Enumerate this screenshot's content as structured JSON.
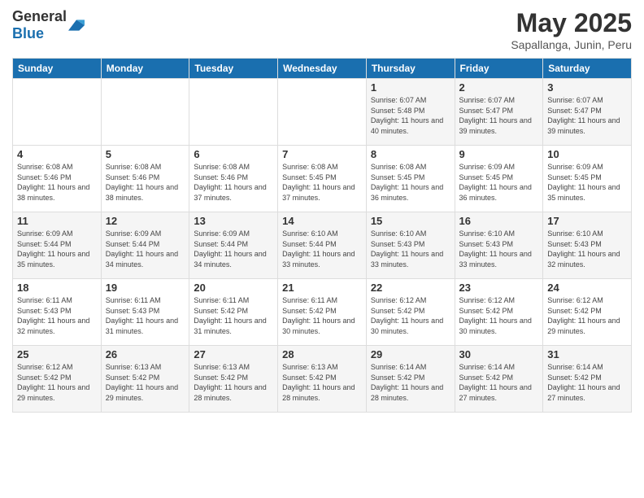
{
  "logo": {
    "general": "General",
    "blue": "Blue"
  },
  "title": "May 2025",
  "subtitle": "Sapallanga, Junin, Peru",
  "headers": [
    "Sunday",
    "Monday",
    "Tuesday",
    "Wednesday",
    "Thursday",
    "Friday",
    "Saturday"
  ],
  "weeks": [
    [
      {
        "day": "",
        "sunrise": "",
        "sunset": "",
        "daylight": ""
      },
      {
        "day": "",
        "sunrise": "",
        "sunset": "",
        "daylight": ""
      },
      {
        "day": "",
        "sunrise": "",
        "sunset": "",
        "daylight": ""
      },
      {
        "day": "",
        "sunrise": "",
        "sunset": "",
        "daylight": ""
      },
      {
        "day": "1",
        "sunrise": "Sunrise: 6:07 AM",
        "sunset": "Sunset: 5:48 PM",
        "daylight": "Daylight: 11 hours and 40 minutes."
      },
      {
        "day": "2",
        "sunrise": "Sunrise: 6:07 AM",
        "sunset": "Sunset: 5:47 PM",
        "daylight": "Daylight: 11 hours and 39 minutes."
      },
      {
        "day": "3",
        "sunrise": "Sunrise: 6:07 AM",
        "sunset": "Sunset: 5:47 PM",
        "daylight": "Daylight: 11 hours and 39 minutes."
      }
    ],
    [
      {
        "day": "4",
        "sunrise": "Sunrise: 6:08 AM",
        "sunset": "Sunset: 5:46 PM",
        "daylight": "Daylight: 11 hours and 38 minutes."
      },
      {
        "day": "5",
        "sunrise": "Sunrise: 6:08 AM",
        "sunset": "Sunset: 5:46 PM",
        "daylight": "Daylight: 11 hours and 38 minutes."
      },
      {
        "day": "6",
        "sunrise": "Sunrise: 6:08 AM",
        "sunset": "Sunset: 5:46 PM",
        "daylight": "Daylight: 11 hours and 37 minutes."
      },
      {
        "day": "7",
        "sunrise": "Sunrise: 6:08 AM",
        "sunset": "Sunset: 5:45 PM",
        "daylight": "Daylight: 11 hours and 37 minutes."
      },
      {
        "day": "8",
        "sunrise": "Sunrise: 6:08 AM",
        "sunset": "Sunset: 5:45 PM",
        "daylight": "Daylight: 11 hours and 36 minutes."
      },
      {
        "day": "9",
        "sunrise": "Sunrise: 6:09 AM",
        "sunset": "Sunset: 5:45 PM",
        "daylight": "Daylight: 11 hours and 36 minutes."
      },
      {
        "day": "10",
        "sunrise": "Sunrise: 6:09 AM",
        "sunset": "Sunset: 5:45 PM",
        "daylight": "Daylight: 11 hours and 35 minutes."
      }
    ],
    [
      {
        "day": "11",
        "sunrise": "Sunrise: 6:09 AM",
        "sunset": "Sunset: 5:44 PM",
        "daylight": "Daylight: 11 hours and 35 minutes."
      },
      {
        "day": "12",
        "sunrise": "Sunrise: 6:09 AM",
        "sunset": "Sunset: 5:44 PM",
        "daylight": "Daylight: 11 hours and 34 minutes."
      },
      {
        "day": "13",
        "sunrise": "Sunrise: 6:09 AM",
        "sunset": "Sunset: 5:44 PM",
        "daylight": "Daylight: 11 hours and 34 minutes."
      },
      {
        "day": "14",
        "sunrise": "Sunrise: 6:10 AM",
        "sunset": "Sunset: 5:44 PM",
        "daylight": "Daylight: 11 hours and 33 minutes."
      },
      {
        "day": "15",
        "sunrise": "Sunrise: 6:10 AM",
        "sunset": "Sunset: 5:43 PM",
        "daylight": "Daylight: 11 hours and 33 minutes."
      },
      {
        "day": "16",
        "sunrise": "Sunrise: 6:10 AM",
        "sunset": "Sunset: 5:43 PM",
        "daylight": "Daylight: 11 hours and 33 minutes."
      },
      {
        "day": "17",
        "sunrise": "Sunrise: 6:10 AM",
        "sunset": "Sunset: 5:43 PM",
        "daylight": "Daylight: 11 hours and 32 minutes."
      }
    ],
    [
      {
        "day": "18",
        "sunrise": "Sunrise: 6:11 AM",
        "sunset": "Sunset: 5:43 PM",
        "daylight": "Daylight: 11 hours and 32 minutes."
      },
      {
        "day": "19",
        "sunrise": "Sunrise: 6:11 AM",
        "sunset": "Sunset: 5:43 PM",
        "daylight": "Daylight: 11 hours and 31 minutes."
      },
      {
        "day": "20",
        "sunrise": "Sunrise: 6:11 AM",
        "sunset": "Sunset: 5:42 PM",
        "daylight": "Daylight: 11 hours and 31 minutes."
      },
      {
        "day": "21",
        "sunrise": "Sunrise: 6:11 AM",
        "sunset": "Sunset: 5:42 PM",
        "daylight": "Daylight: 11 hours and 30 minutes."
      },
      {
        "day": "22",
        "sunrise": "Sunrise: 6:12 AM",
        "sunset": "Sunset: 5:42 PM",
        "daylight": "Daylight: 11 hours and 30 minutes."
      },
      {
        "day": "23",
        "sunrise": "Sunrise: 6:12 AM",
        "sunset": "Sunset: 5:42 PM",
        "daylight": "Daylight: 11 hours and 30 minutes."
      },
      {
        "day": "24",
        "sunrise": "Sunrise: 6:12 AM",
        "sunset": "Sunset: 5:42 PM",
        "daylight": "Daylight: 11 hours and 29 minutes."
      }
    ],
    [
      {
        "day": "25",
        "sunrise": "Sunrise: 6:12 AM",
        "sunset": "Sunset: 5:42 PM",
        "daylight": "Daylight: 11 hours and 29 minutes."
      },
      {
        "day": "26",
        "sunrise": "Sunrise: 6:13 AM",
        "sunset": "Sunset: 5:42 PM",
        "daylight": "Daylight: 11 hours and 29 minutes."
      },
      {
        "day": "27",
        "sunrise": "Sunrise: 6:13 AM",
        "sunset": "Sunset: 5:42 PM",
        "daylight": "Daylight: 11 hours and 28 minutes."
      },
      {
        "day": "28",
        "sunrise": "Sunrise: 6:13 AM",
        "sunset": "Sunset: 5:42 PM",
        "daylight": "Daylight: 11 hours and 28 minutes."
      },
      {
        "day": "29",
        "sunrise": "Sunrise: 6:14 AM",
        "sunset": "Sunset: 5:42 PM",
        "daylight": "Daylight: 11 hours and 28 minutes."
      },
      {
        "day": "30",
        "sunrise": "Sunrise: 6:14 AM",
        "sunset": "Sunset: 5:42 PM",
        "daylight": "Daylight: 11 hours and 27 minutes."
      },
      {
        "day": "31",
        "sunrise": "Sunrise: 6:14 AM",
        "sunset": "Sunset: 5:42 PM",
        "daylight": "Daylight: 11 hours and 27 minutes."
      }
    ]
  ]
}
